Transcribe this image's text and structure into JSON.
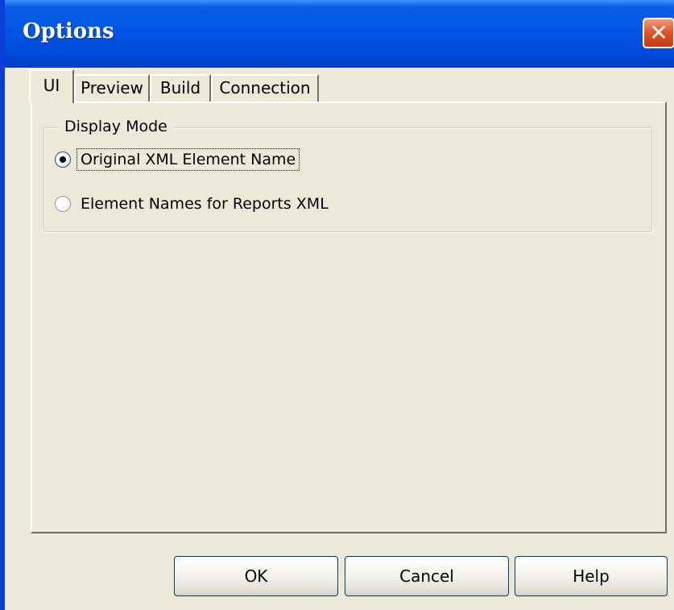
{
  "window": {
    "title": "Options",
    "close_glyph": "✕"
  },
  "tabs": [
    {
      "label": "UI",
      "active": true
    },
    {
      "label": "Preview",
      "active": false
    },
    {
      "label": "Build",
      "active": false
    },
    {
      "label": "Connection",
      "active": false
    }
  ],
  "display_mode": {
    "legend": "Display Mode",
    "options": [
      {
        "label": "Original XML Element Name",
        "checked": true
      },
      {
        "label": "Element Names for Reports XML",
        "checked": false
      }
    ]
  },
  "buttons": {
    "ok": "OK",
    "cancel": "Cancel",
    "help": "Help"
  },
  "colors": {
    "titlebar": "#0055E5",
    "face": "#ECE9D8",
    "close": "#E2552C"
  }
}
